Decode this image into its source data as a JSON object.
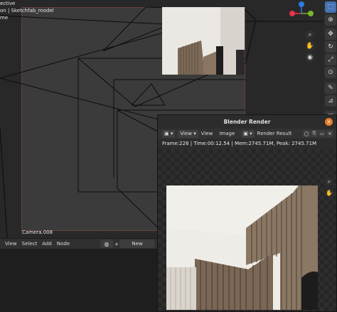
{
  "viewport": {
    "info_lines": [
      "ective",
      "on | Sketchfab_model",
      "me"
    ],
    "camera_label": "Camera.008"
  },
  "gizmo": {
    "axis_y_label": "Y",
    "axis_z_label": "Z",
    "colors": {
      "x": "#e8324f",
      "y": "#7bb72a",
      "z": "#2b7be4"
    }
  },
  "toolbar": {
    "icons": [
      "select-box-icon",
      "cursor-icon",
      "move-icon",
      "rotate-icon",
      "scale-icon",
      "annotate-icon",
      "measure-icon",
      "add-cube-icon"
    ]
  },
  "node_editor": {
    "menu": [
      "View",
      "Select",
      "Add",
      "Node"
    ],
    "new_button": "New"
  },
  "render_window": {
    "title": "Blender Render",
    "view_menu": "View",
    "menu_items": [
      "View",
      "Image"
    ],
    "image_selector": "Render Result",
    "stats": "Frame:226 | Time:00:12.54 | Mem:2745.71M, Peak: 2745.71M"
  }
}
